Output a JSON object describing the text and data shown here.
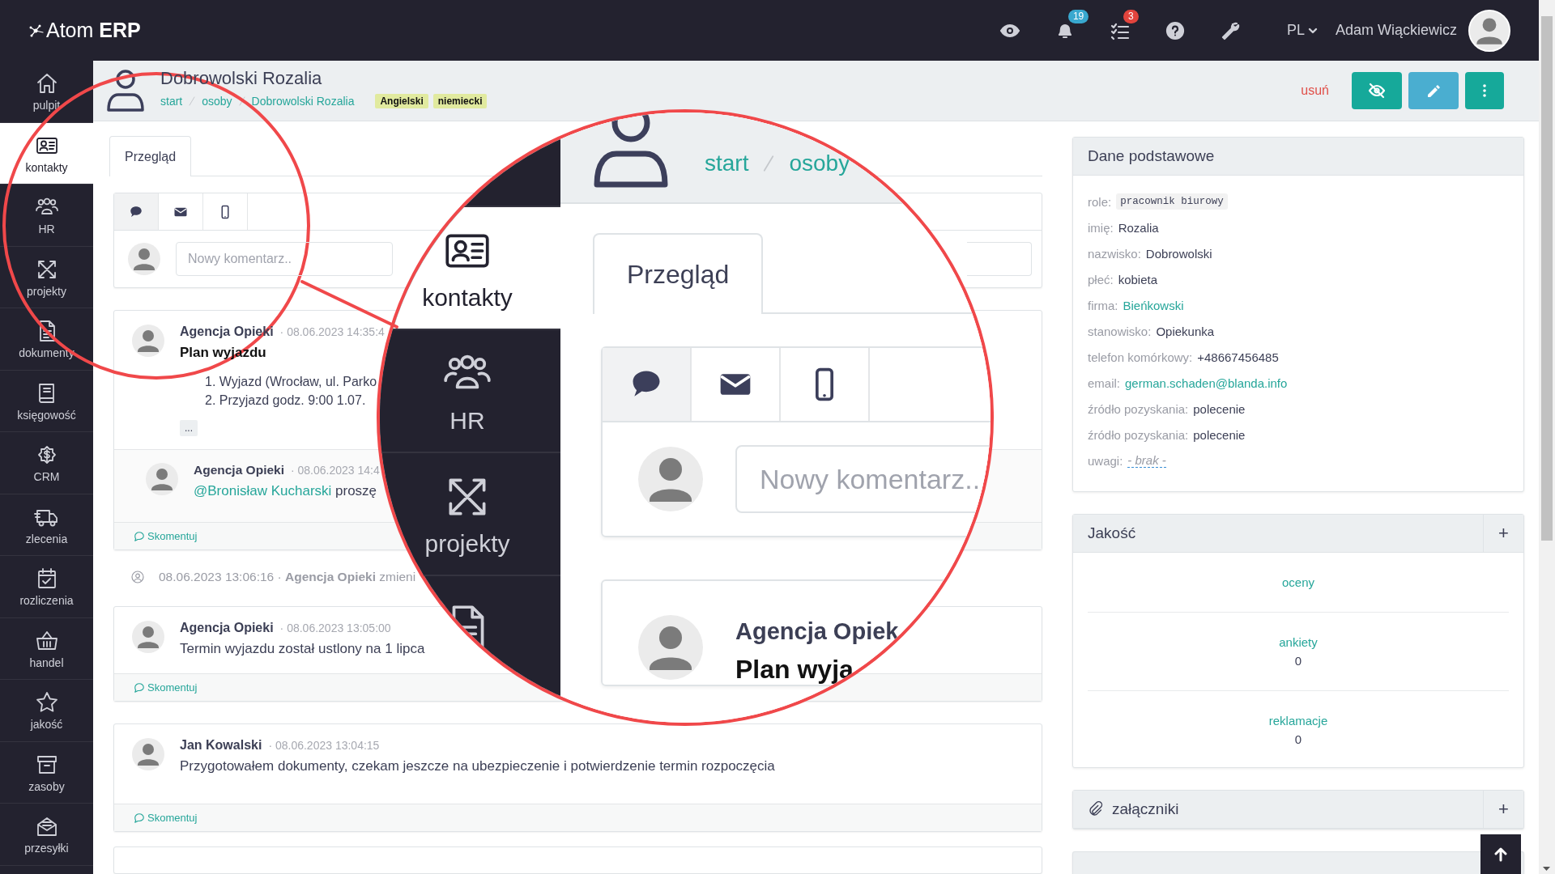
{
  "top_bar": {
    "logo": "Atom **ERP**",
    "notifications_badge": "19",
    "tasks_badge": "3",
    "language": "PL",
    "user_name": "Adam Wiąckiewicz"
  },
  "sidebar": {
    "items": [
      {
        "label": "pulpit",
        "selected": false
      },
      {
        "label": "kontakty",
        "selected": true
      },
      {
        "label": "HR",
        "selected": false
      },
      {
        "label": "projekty",
        "selected": false
      },
      {
        "label": "dokumenty",
        "selected": false
      },
      {
        "label": "księgowość",
        "selected": false
      },
      {
        "label": "CRM",
        "selected": false
      },
      {
        "label": "zlecenia",
        "selected": false
      },
      {
        "label": "rozliczenia",
        "selected": false
      },
      {
        "label": "handel",
        "selected": false
      },
      {
        "label": "jakość",
        "selected": false
      },
      {
        "label": "zasoby",
        "selected": false
      },
      {
        "label": "przesyłki",
        "selected": false
      }
    ]
  },
  "page_header": {
    "title": "Dobrowolski Rozalia",
    "breadcrumbs": [
      "start",
      "osoby",
      "Dobrowolski Rozalia"
    ],
    "tags": [
      "Angielski",
      "niemiecki"
    ],
    "delete_link": "usuń"
  },
  "tabs": [
    {
      "label": "Przegląd",
      "selected": true
    }
  ],
  "channel_tabs": [
    {
      "selected": true
    },
    {
      "selected": false
    },
    {
      "selected": false
    }
  ],
  "comment_field": {
    "placeholder": "Nowy komentarz.."
  },
  "feed": [
    {
      "kind": "post",
      "author": "Agencja Opieki",
      "time": "· 08.06.2023 14:35:4",
      "title": "Plan wyjazdu",
      "list": [
        "1. Wyjazd (Wrocław, ul. Parko",
        "2. Przyjazd godz. 9:00 1.07."
      ],
      "more": "...",
      "replies": [
        {
          "author": "Agencja Opieki",
          "time": "· 08.06.2023 14:4",
          "mention": "@Bronisław Kucharski",
          "text": "proszę"
        }
      ],
      "comment_link": "Skomentuj"
    },
    {
      "kind": "activity",
      "time": "08.06.2023 13:06:16 ·",
      "author": "Agencja Opieki",
      "text": "zmieni"
    },
    {
      "kind": "post",
      "author": "Agencja Opieki",
      "time": "· 08.06.2023 13:05:00",
      "text": "Termin wyjazdu został ustlony na 1 lipca",
      "comment_link": "Skomentuj"
    },
    {
      "kind": "post",
      "author": "Jan Kowalski",
      "time": "· 08.06.2023 13:04:15",
      "text": "Przygotowałem dokumenty, czekam jeszcze na ubezpieczenie i potwierdzenie termin rozpoczęcia",
      "comment_link": "Skomentuj"
    }
  ],
  "details": {
    "title": "Dane podstawowe",
    "fields": [
      {
        "label": "role:",
        "value": "pracownik biurowy",
        "kind": "code"
      },
      {
        "label": "imię:",
        "value": "Rozalia",
        "kind": "text"
      },
      {
        "label": "nazwisko:",
        "value": "Dobrowolski",
        "kind": "text"
      },
      {
        "label": "płeć:",
        "value": "kobieta",
        "kind": "text"
      },
      {
        "label": "firma:",
        "value": "Bieńkowski",
        "kind": "link"
      },
      {
        "label": "stanowisko:",
        "value": "Opiekunka",
        "kind": "text"
      },
      {
        "label": "telefon komórkowy:",
        "value": "+48667456485",
        "kind": "text"
      },
      {
        "label": "email:",
        "value": "german.schaden@blanda.info",
        "kind": "link"
      },
      {
        "label": "źródło pozyskania:",
        "value": "polecenie",
        "kind": "text"
      },
      {
        "label": "źródło pozyskania:",
        "value": "polecenie",
        "kind": "text"
      },
      {
        "label": "uwagi:",
        "value": "- brak -",
        "kind": "empty"
      }
    ]
  },
  "quality": {
    "title": "Jakość",
    "add": "+",
    "items": [
      {
        "label": "oceny"
      },
      {
        "label": "ankiety",
        "count": "0"
      },
      {
        "label": "reklamacje",
        "count": "0"
      }
    ]
  },
  "attachments": {
    "title": "załączniki",
    "add": "+"
  },
  "magnifier": {
    "sidebar_items": [
      {
        "label": "kontakty",
        "selected": true
      },
      {
        "label": "HR",
        "selected": false
      },
      {
        "label": "projekty",
        "selected": false
      }
    ],
    "breadcrumbs": [
      "start",
      "osoby"
    ],
    "tab": "Przegląd",
    "placeholder": "Nowy komentarz..",
    "post_author": "Agencja Opiek",
    "post_title": "Plan wyja"
  }
}
